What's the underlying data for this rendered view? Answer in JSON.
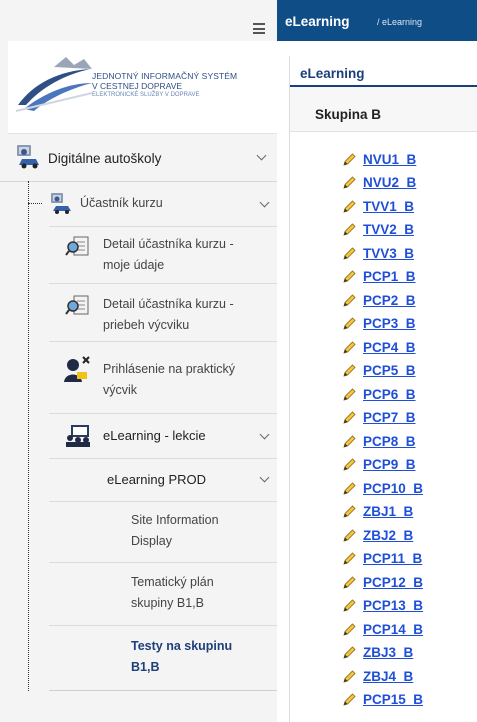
{
  "header": {
    "title": "eLearning",
    "breadcrumb_sep": " / ",
    "breadcrumb_current": "eLearning"
  },
  "logo": {
    "line1": "JEDNOTNÝ INFORMAČNÝ SYSTÉM",
    "line2": "V CESTNEJ DOPRAVE",
    "line3": "ELEKTRONICKÉ SLUŽBY V DOPRAVE"
  },
  "sidebar": {
    "section": {
      "label": "Digitálne autoškoly",
      "icon": "car-user-icon"
    },
    "participant": {
      "label": "Účastník kurzu",
      "icon": "participant-car-icon"
    },
    "items": [
      {
        "label": "Detail účastníka kurzu - moje údaje",
        "line1": "Detail účastníka kurzu -",
        "line2": "moje údaje",
        "icon": "search-document-icon"
      },
      {
        "label": "Detail účastníka kurzu - priebeh výcviku",
        "line1": "Detail účastníka kurzu -",
        "line2": "priebeh výcviku",
        "icon": "search-document-icon"
      },
      {
        "label": "Prihlásenie na praktický výcvik",
        "line1": "Prihlásenie na praktický",
        "line2": "výcvik",
        "icon": "driver-sign-icon"
      }
    ],
    "elearning": {
      "label": "eLearning - lekcie",
      "icon": "classroom-icon"
    },
    "prod": {
      "label": "eLearning PROD"
    },
    "leaves": [
      {
        "line1": "Site Information",
        "line2": "Display"
      },
      {
        "line1": "Tematický plán",
        "line2": "skupiny B1,B"
      },
      {
        "line1": "Testy na skupinu",
        "line2": "B1,B"
      }
    ]
  },
  "main": {
    "heading": "eLearning",
    "group": "Skupina B",
    "tests": [
      "NVU1_B",
      "NVU2_B",
      "TVV1_B",
      "TVV2_B",
      "TVV3_B",
      "PCP1_B",
      "PCP2_B",
      "PCP3_B",
      "PCP4_B",
      "PCP5_B",
      "PCP6_B",
      "PCP7_B",
      "PCP8_B",
      "PCP9_B",
      "PCP10_B",
      "ZBJ1_B",
      "ZBJ2_B",
      "PCP11_B",
      "PCP12_B",
      "PCP13_B",
      "PCP14_B",
      "ZBJ3_B",
      "ZBJ4_B",
      "PCP15_B"
    ]
  },
  "colors": {
    "topbar": "#0f4d87",
    "link": "#1f4fd8",
    "accent": "#1a3f7a",
    "sidebar_bg": "#f4f4f4"
  }
}
